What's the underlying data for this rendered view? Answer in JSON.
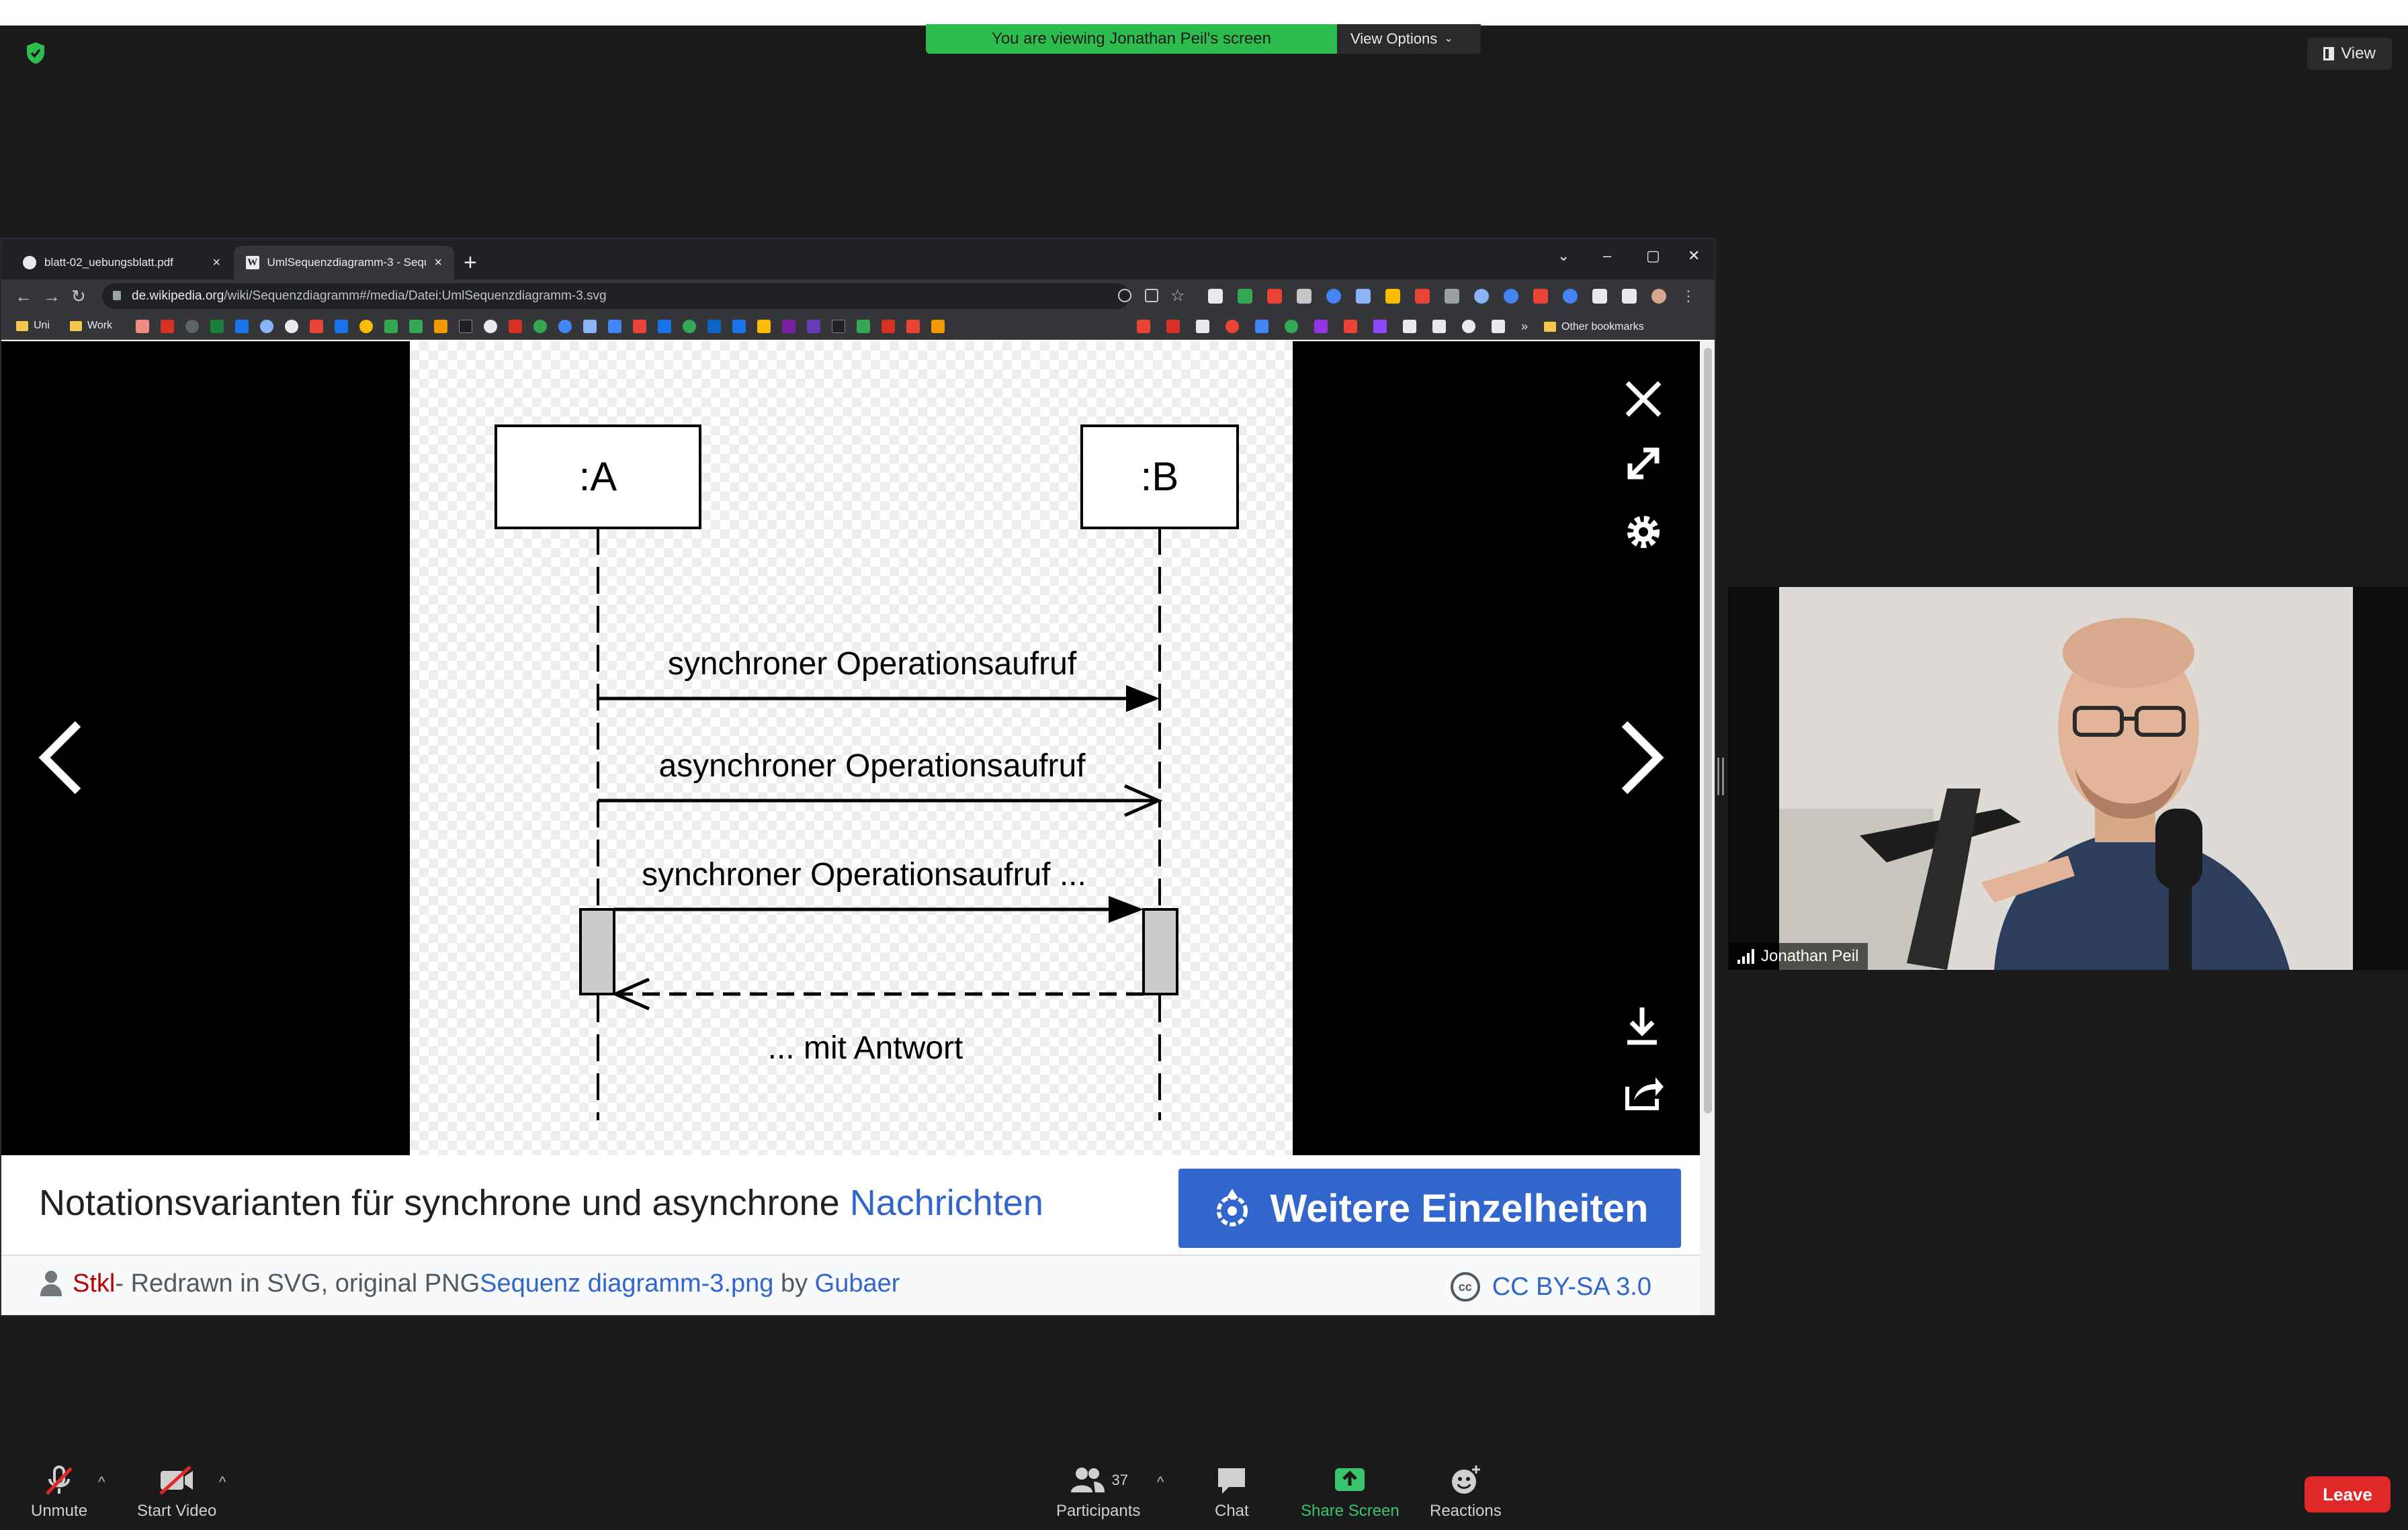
{
  "banner": {
    "viewing_text": "You are viewing Jonathan Peil's screen",
    "view_options": "View Options"
  },
  "view_button": "View",
  "browser": {
    "tabs": [
      {
        "title": "blatt-02_uebungsblatt.pdf",
        "active": false
      },
      {
        "title": "UmlSequenzdiagramm-3 - Sequ",
        "active": true
      }
    ],
    "url_domain": "de.wikipedia.org",
    "url_path": "/wiki/Sequenzdiagramm#/media/Datei:UmlSequenzdiagramm-3.svg",
    "bookmarks": {
      "uni": "Uni",
      "work": "Work",
      "other": "Other bookmarks"
    }
  },
  "diagram": {
    "objects": [
      ":A",
      ":B"
    ],
    "messages": {
      "sync": "synchroner Operationsaufruf",
      "async": "asynchroner Operationsaufruf",
      "sync_reply": "synchroner Operationsaufruf ...",
      "reply": "... mit Antwort"
    }
  },
  "caption": {
    "text": "Notationsvarianten für synchrone und asynchrone ",
    "link": "Nachrichten"
  },
  "details_button": "Weitere Einzelheiten",
  "attribution": {
    "author": "Stkl",
    "text": " - Redrawn in SVG, original PNG ",
    "file_link": "Sequenz diagramm-3.png",
    "by": " by ",
    "original_author": "Gubaer",
    "license": "CC BY-SA 3.0",
    "cc_icon_text": "cc"
  },
  "participant": {
    "name": "Jonathan Peil"
  },
  "controls": {
    "unmute": "Unmute",
    "start_video": "Start Video",
    "participants": "Participants",
    "participants_count": "37",
    "chat": "Chat",
    "share_screen": "Share Screen",
    "reactions": "Reactions",
    "leave": "Leave"
  },
  "colors": {
    "zoom_green": "#2dbc4e",
    "wiki_blue": "#3366cc",
    "leave_red": "#e02828",
    "author_red": "#ba0000"
  }
}
